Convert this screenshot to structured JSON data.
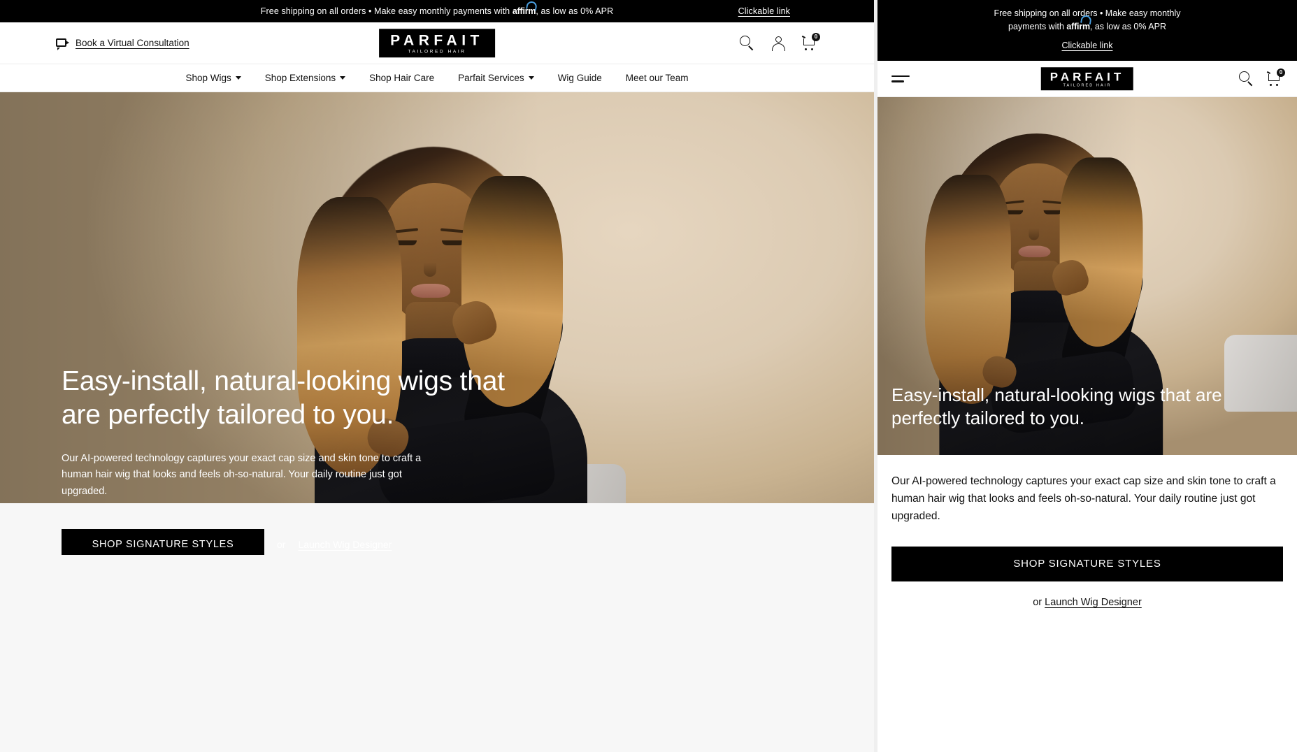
{
  "announcement": {
    "message_prefix": "Free shipping on all orders • Make easy monthly payments with ",
    "affirm_label": "affirm",
    "message_suffix": ", as low as 0% APR",
    "clickable_link": "Clickable link",
    "mobile_line1": "Free shipping on all orders • Make easy monthly",
    "mobile_affirm": "affirm",
    "mobile_line2_prefix": "payments with ",
    "mobile_line2_suffix": ", as low as 0% APR"
  },
  "header": {
    "consultation_label": "Book a Virtual Consultation",
    "consultation_icon": "video-camera-icon",
    "logo_word": "PARFAIT",
    "logo_tagline": "TAILORED HAIR",
    "icons": {
      "search": "search-icon",
      "account": "account-icon",
      "cart": "cart-icon",
      "cart_count": "0"
    }
  },
  "nav": {
    "items": [
      {
        "label": "Shop Wigs",
        "has_dropdown": true
      },
      {
        "label": "Shop Extensions",
        "has_dropdown": true
      },
      {
        "label": "Shop Hair Care",
        "has_dropdown": false
      },
      {
        "label": "Parfait Services",
        "has_dropdown": true
      },
      {
        "label": "Wig Guide",
        "has_dropdown": false
      },
      {
        "label": "Meet our Team",
        "has_dropdown": false
      }
    ]
  },
  "hero": {
    "headline": "Easy-install, natural-looking wigs that are perfectly tailored to you.",
    "body": "Our AI-powered technology captures your exact cap size and skin tone to craft a human hair wig that looks and feels oh-so-natural. Your daily routine just got upgraded.",
    "cta_primary": "SHOP SIGNATURE STYLES",
    "or_text": "or",
    "cta_secondary": "Launch Wig Designer"
  },
  "mobile": {
    "headline": "Easy-install, natural-looking wigs that are perfectly tailored to you.",
    "body": "Our AI-powered technology captures your exact cap size and skin tone to craft a human hair wig that looks and feels oh-so-natural. Your daily routine just got upgraded.",
    "cta_primary": "SHOP SIGNATURE STYLES",
    "or_text": "or",
    "cta_secondary": "Launch Wig Designer",
    "menu_icon": "hamburger-menu-icon",
    "search_icon": "search-icon",
    "cart_icon": "cart-icon",
    "cart_count": "0"
  },
  "colors": {
    "brand_black": "#000000",
    "page_background": "#ffffff",
    "affirm_accent": "#4a9fe0"
  }
}
